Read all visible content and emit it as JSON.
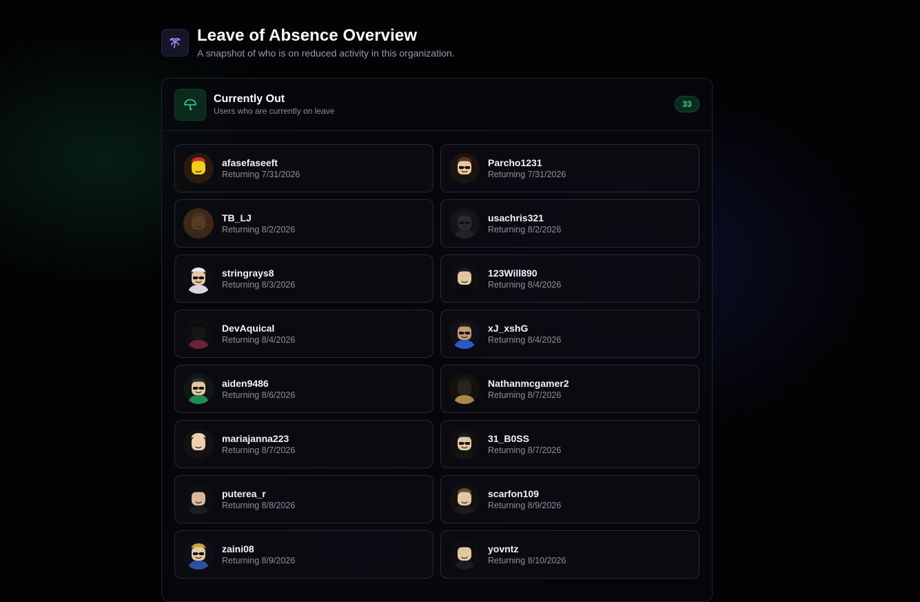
{
  "page": {
    "title": "Leave of Absence Overview",
    "subtitle": "A snapshot of who is on reduced activity in this organization.",
    "icon": "palm-tree-icon",
    "accent_color": "#a78bfa"
  },
  "section": {
    "title": "Currently Out",
    "subtitle": "Users who are currently on leave",
    "icon": "umbrella-icon",
    "count": "33",
    "accent_color": "#3ad38c"
  },
  "users": [
    {
      "name": "afasefaseeft",
      "returning": "Returning 7/31/2026",
      "avatar": "yellow-avatar-red-hat"
    },
    {
      "name": "Parcho1231",
      "returning": "Returning 7/31/2026",
      "avatar": "avatar-sunglasses-brown-hair"
    },
    {
      "name": "TB_LJ",
      "returning": "Returning 8/2/2026",
      "avatar": "brown-wood-avatar"
    },
    {
      "name": "usachris321",
      "returning": "Returning 8/2/2026",
      "avatar": "dark-avatar-hood"
    },
    {
      "name": "stringrays8",
      "returning": "Returning 8/3/2026",
      "avatar": "avatar-white-hat-striped"
    },
    {
      "name": "123Will890",
      "returning": "Returning 8/4/2026",
      "avatar": "avatar-black-suit"
    },
    {
      "name": "DevAquical",
      "returning": "Returning 8/4/2026",
      "avatar": "dark-avatar-maroon"
    },
    {
      "name": "xJ_xshG",
      "returning": "Returning 8/4/2026",
      "avatar": "avatar-blue-item"
    },
    {
      "name": "aiden9486",
      "returning": "Returning 8/6/2026",
      "avatar": "avatar-goggles-green"
    },
    {
      "name": "Nathanmcgamer2",
      "returning": "Returning 8/7/2026",
      "avatar": "avatar-gold-chain"
    },
    {
      "name": "mariajanna223",
      "returning": "Returning 8/7/2026",
      "avatar": "avatar-bald-beige"
    },
    {
      "name": "31_B0SS",
      "returning": "Returning 8/7/2026",
      "avatar": "avatar-beret-sunglasses"
    },
    {
      "name": "puterea_r",
      "returning": "Returning 8/8/2026",
      "avatar": "avatar-black-hair"
    },
    {
      "name": "scarfon109",
      "returning": "Returning 8/9/2026",
      "avatar": "avatar-brown-messy-hair"
    },
    {
      "name": "zaini08",
      "returning": "Returning 8/9/2026",
      "avatar": "avatar-blonde-blue"
    },
    {
      "name": "yovntz",
      "returning": "Returning 8/10/2026",
      "avatar": "avatar-black-hair-2"
    }
  ]
}
